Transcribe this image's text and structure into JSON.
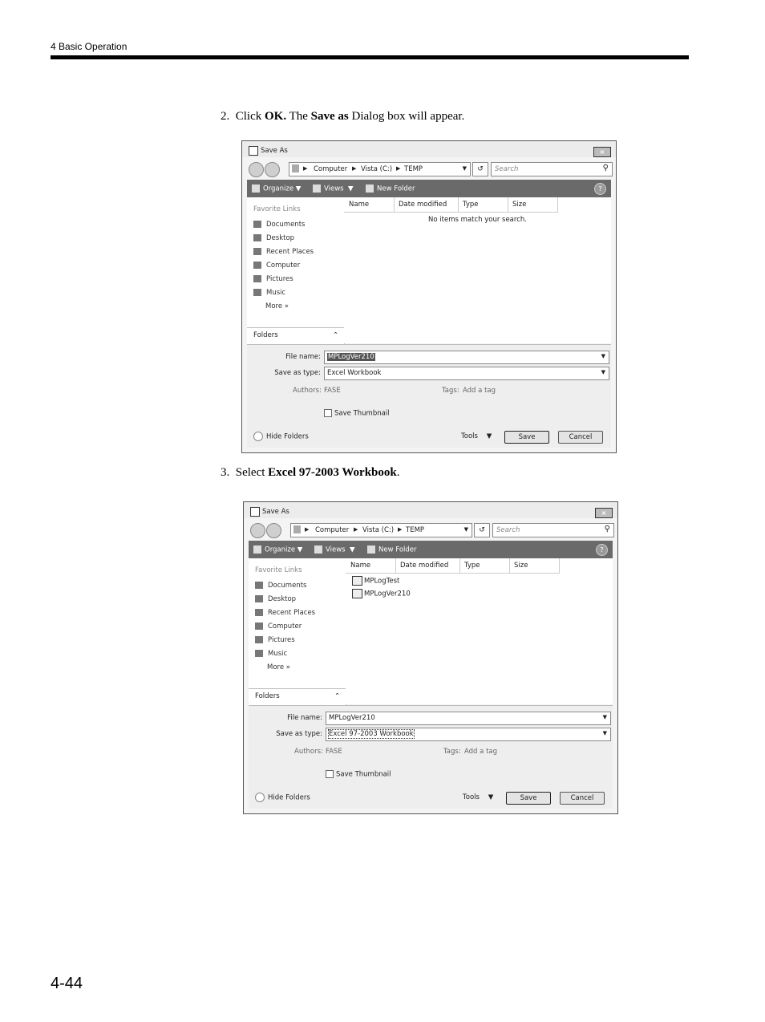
{
  "header": {
    "section": "4  Basic Operation",
    "page_number": "4-44"
  },
  "steps": [
    {
      "num": "2.",
      "pre": "Click ",
      "b1": "OK.",
      "mid": " The ",
      "b2": "Save as",
      "post": " Dialog box will appear."
    },
    {
      "num": "3.",
      "pre": "Select ",
      "b1": "Excel 97-2003 Workbook",
      "post": "."
    }
  ],
  "dialog": {
    "title": "Save As",
    "close": "×",
    "address": {
      "c1": "Computer",
      "c2": "Vista (C:)",
      "c3": "TEMP",
      "arrow": "▶",
      "dd": "▼"
    },
    "refresh": "↺",
    "search_placeholder": "Search",
    "search_icon": "⚲",
    "toolbar": {
      "organize": "Organize",
      "views": "Views",
      "new_folder": "New Folder",
      "dd": "▼",
      "help": "?"
    },
    "favorites_heading": "Favorite Links",
    "links": [
      "Documents",
      "Desktop",
      "Recent Places",
      "Computer",
      "Pictures",
      "Music"
    ],
    "more": "More  »",
    "folders": "Folders",
    "folders_chevron": "⌃",
    "columns": [
      "Name",
      "Date modified",
      "Type",
      "Size"
    ],
    "labels": {
      "file_name": "File name:",
      "save_as_type": "Save as type:",
      "authors": "Authors:",
      "tags": "Tags:"
    },
    "authors_value": "FASE",
    "tags_value": "Add a tag",
    "save_thumbnail": "Save Thumbnail",
    "hide_folders": "Hide Folders",
    "tools": "Tools",
    "save": "Save",
    "cancel": "Cancel",
    "file_name_value": "MPLogVer210"
  },
  "dialog1": {
    "empty_message": "No items match your search.",
    "save_type": "Excel Workbook"
  },
  "dialog2": {
    "files": [
      "MPLogTest",
      "MPLogVer210"
    ],
    "save_type": "Excel 97-2003 Workbook"
  }
}
